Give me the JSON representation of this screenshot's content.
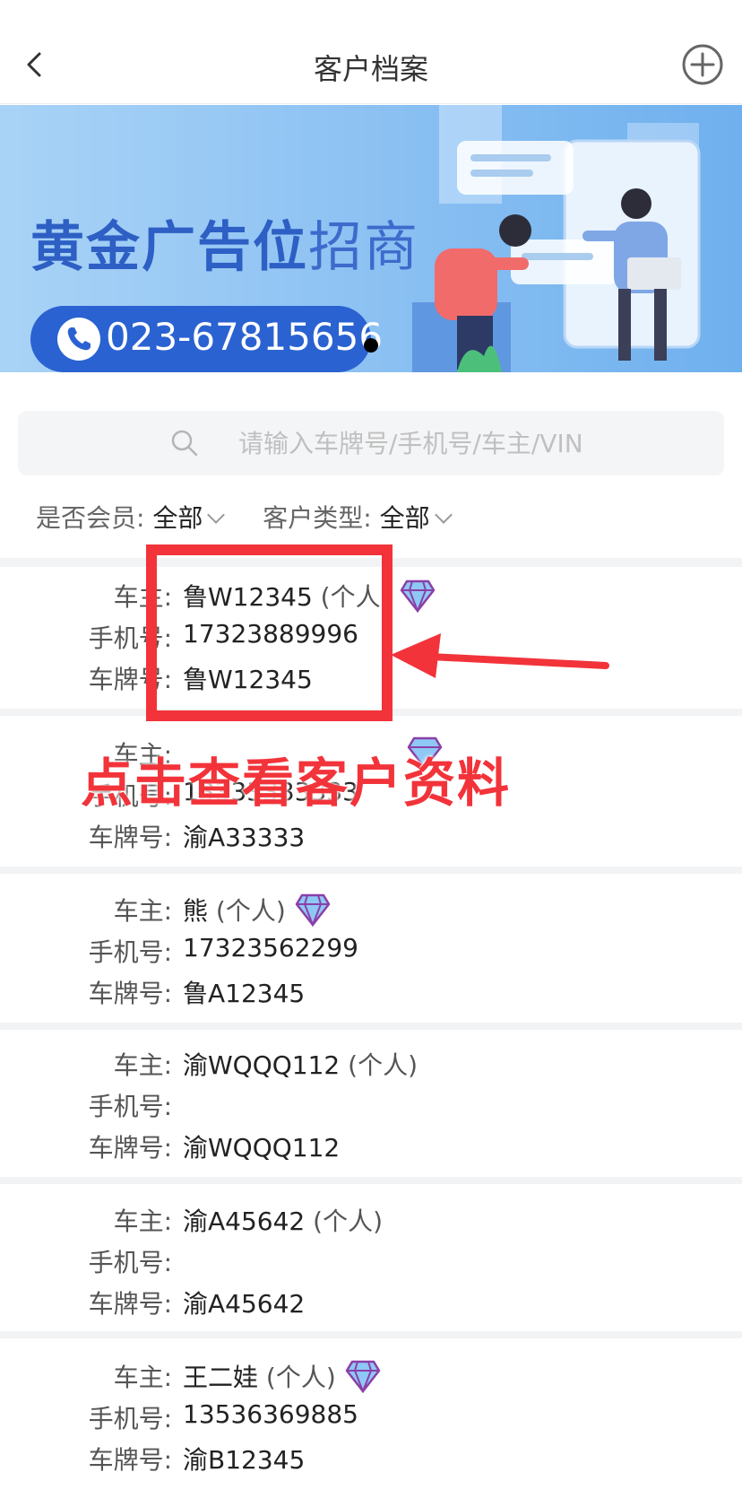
{
  "header": {
    "title": "客户档案",
    "back_icon": "chevron-left-icon",
    "add_icon": "plus-circle-icon"
  },
  "banner": {
    "title_bold": "黄金广告位",
    "title_light": "招商",
    "phone": "023-67815656",
    "phone_icon": "phone-icon"
  },
  "search": {
    "placeholder": "请输入车牌号/手机号/车主/VIN",
    "icon": "search-icon"
  },
  "filters": [
    {
      "label": "是否会员:",
      "value": "全部"
    },
    {
      "label": "客户类型:",
      "value": "全部"
    }
  ],
  "labels": {
    "owner": "车主:",
    "phone": "手机号:",
    "plate": "车牌号:"
  },
  "customers": [
    {
      "owner": "鲁W12345",
      "type": "(个人)",
      "vip": true,
      "phone": "17323889996",
      "plate": "鲁W12345"
    },
    {
      "owner": "",
      "type": "",
      "vip": true,
      "phone": "13333333333",
      "plate": "渝A33333"
    },
    {
      "owner": "熊",
      "type": "(个人)",
      "vip": true,
      "phone": "17323562299",
      "plate": "鲁A12345"
    },
    {
      "owner": "渝WQQQ112",
      "type": "(个人)",
      "vip": false,
      "phone": "",
      "plate": "渝WQQQ112"
    },
    {
      "owner": "渝A45642",
      "type": "(个人)",
      "vip": false,
      "phone": "",
      "plate": "渝A45642"
    },
    {
      "owner": "王二娃",
      "type": "(个人)",
      "vip": true,
      "phone": "13536369885",
      "plate": "渝B12345"
    }
  ],
  "annotation": {
    "text": "点击查看客户资料",
    "color": "#f2333a"
  },
  "colors": {
    "accent": "#2a62d1",
    "annotation": "#f2333a"
  }
}
